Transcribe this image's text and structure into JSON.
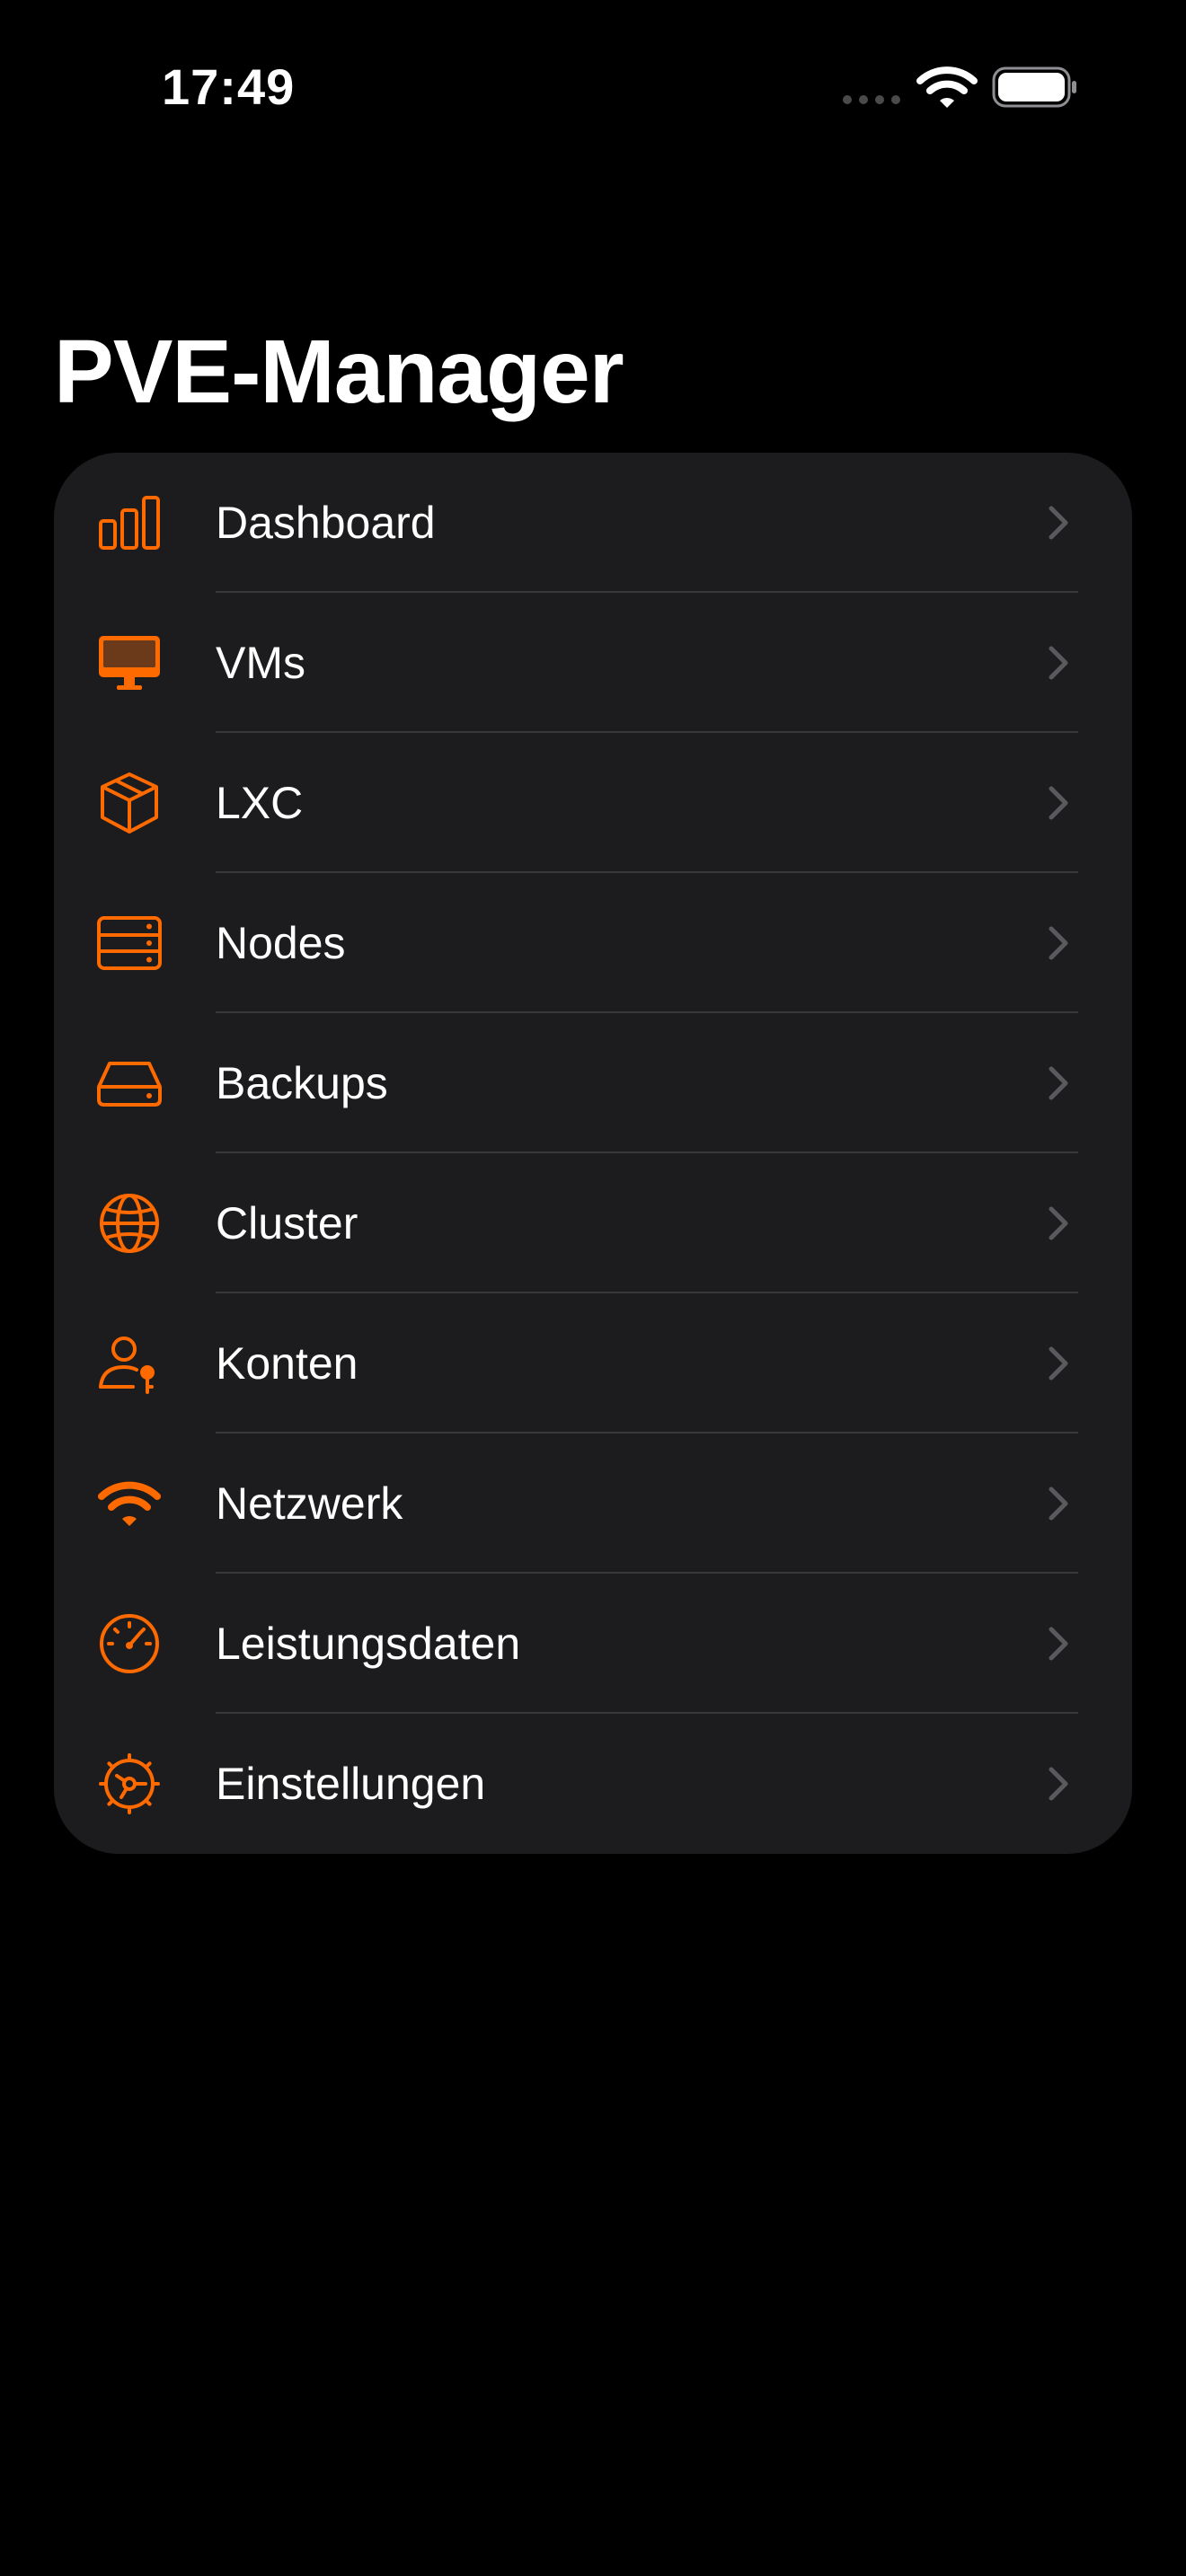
{
  "status_bar": {
    "time": "17:49"
  },
  "app": {
    "title": "PVE-Manager"
  },
  "colors": {
    "accent": "#ff6a00",
    "card_background": "#1c1c1e",
    "divider": "#38383a",
    "chevron": "#5a5a5e"
  },
  "menu": {
    "items": [
      {
        "label": "Dashboard",
        "icon": "bar-chart-icon"
      },
      {
        "label": "VMs",
        "icon": "desktop-monitor-icon"
      },
      {
        "label": "LXC",
        "icon": "cube-icon"
      },
      {
        "label": "Nodes",
        "icon": "server-rack-icon"
      },
      {
        "label": "Backups",
        "icon": "hard-drive-icon"
      },
      {
        "label": "Cluster",
        "icon": "globe-icon"
      },
      {
        "label": "Konten",
        "icon": "user-key-icon"
      },
      {
        "label": "Netzwerk",
        "icon": "wifi-icon"
      },
      {
        "label": "Leistungsdaten",
        "icon": "gauge-icon"
      },
      {
        "label": "Einstellungen",
        "icon": "gear-icon"
      }
    ]
  }
}
